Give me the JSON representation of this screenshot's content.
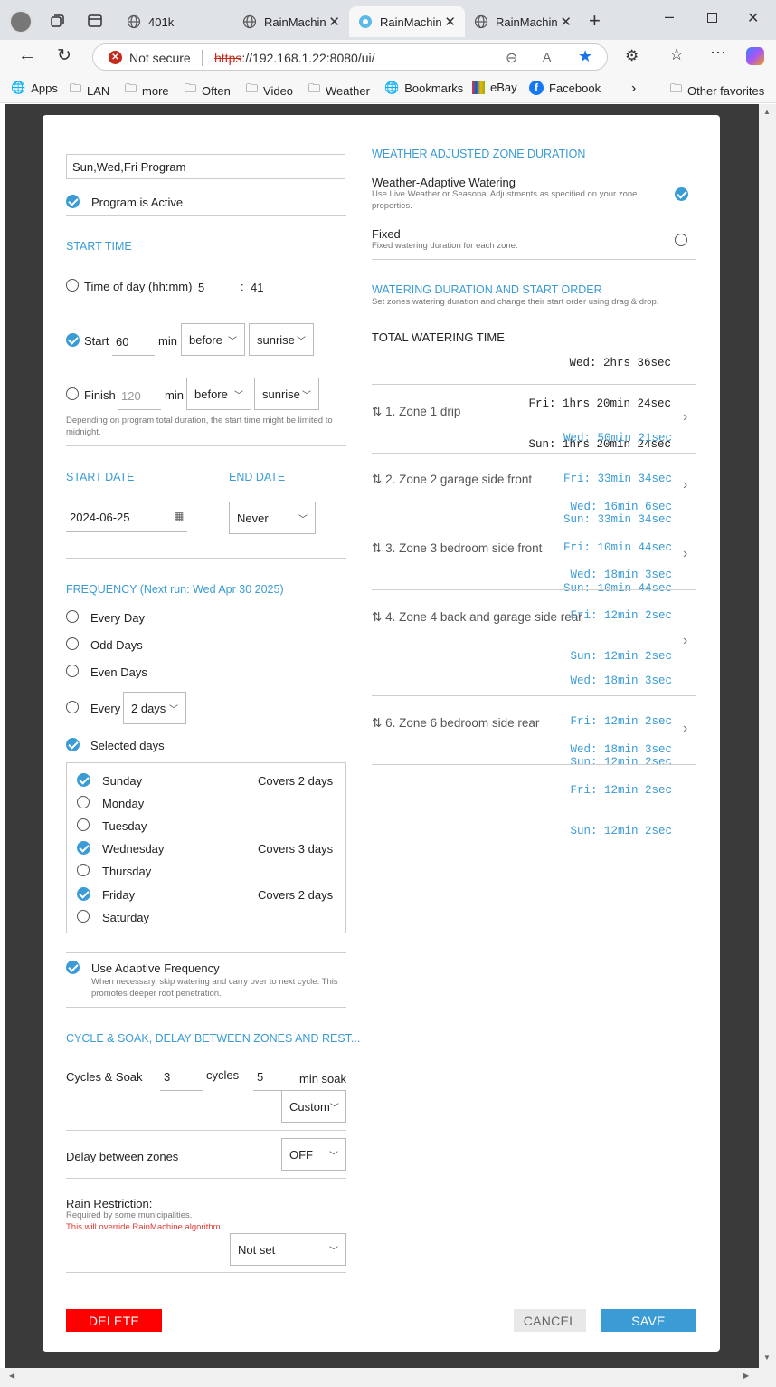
{
  "browser": {
    "tabs": [
      {
        "label": "401k"
      },
      {
        "label": "RainMachine"
      },
      {
        "label": "RainMachine"
      },
      {
        "label": "RainMachine"
      }
    ],
    "security_label": "Not secure",
    "url_scheme": "https",
    "url_rest": "://192.168.1.22:8080/ui/",
    "bookmarks": [
      "Apps",
      "LAN",
      "more",
      "Often",
      "Video",
      "Weather",
      "Bookmarks",
      "eBay",
      "Facebook"
    ],
    "other_favorites": "Other favorites"
  },
  "program": {
    "name": "Sun,Wed,Fri Program",
    "active_label": "Program is Active"
  },
  "start_time": {
    "heading": "START TIME",
    "time_of_day_label": "Time of day (hh:mm)",
    "hh": "5",
    "mm": "41",
    "colon": ":",
    "start_label": "Start",
    "start_value": "60",
    "finish_label": "Finish",
    "finish_value": "120",
    "min_label": "min",
    "before_label": "before",
    "sunrise_label": "sunrise",
    "note": "Depending on program total duration, the start time might be limited to midnight."
  },
  "dates": {
    "start_heading": "START DATE",
    "end_heading": "END DATE",
    "start_value": "2024-06-25",
    "end_value": "Never"
  },
  "frequency": {
    "heading": "FREQUENCY (Next run: Wed Apr 30 2025)",
    "every_day": "Every Day",
    "odd_days": "Odd Days",
    "even_days": "Even Days",
    "every": "Every",
    "every_value": "2 days",
    "selected_days": "Selected days",
    "days": [
      {
        "name": "Sunday",
        "covers": "Covers 2 days"
      },
      {
        "name": "Monday",
        "covers": ""
      },
      {
        "name": "Tuesday",
        "covers": ""
      },
      {
        "name": "Wednesday",
        "covers": "Covers 3 days"
      },
      {
        "name": "Thursday",
        "covers": ""
      },
      {
        "name": "Friday",
        "covers": "Covers 2 days"
      },
      {
        "name": "Saturday",
        "covers": ""
      }
    ],
    "adaptive_label": "Use Adaptive Frequency",
    "adaptive_note": "When necessary, skip watering and carry over to next cycle. This promotes deeper root penetration."
  },
  "cycle": {
    "heading": "CYCLE & SOAK, DELAY BETWEEN ZONES AND REST...",
    "cycles_soak_label": "Cycles & Soak",
    "cycles_value": "3",
    "cycles_label": "cycles",
    "soak_value": "5",
    "soak_label": "min soak",
    "custom_label": "Custom",
    "delay_label": "Delay between zones",
    "delay_value": "OFF",
    "rain_label": "Rain Restriction:",
    "rain_note": "Required by some municipalities.",
    "rain_warning": "This will override RainMachine algorithm.",
    "rain_value": "Not set"
  },
  "weather": {
    "heading": "WEATHER ADJUSTED ZONE DURATION",
    "adaptive_label": "Weather-Adaptive Watering",
    "adaptive_note": "Use Live Weather or Seasonal Adjustments as specified on your zone properties.",
    "fixed_label": "Fixed",
    "fixed_note": "Fixed watering duration for each zone."
  },
  "watering": {
    "heading": "WATERING DURATION AND START ORDER",
    "note": "Set zones watering duration and change their start order using drag & drop.",
    "total_label": "TOTAL WATERING TIME",
    "total_lines": [
      "Wed: 2hrs 36sec",
      "Fri: 1hrs 20min 24sec",
      "Sun: 1hrs 20min 24sec"
    ],
    "zones": [
      {
        "label": "1. Zone 1 drip",
        "times": [
          "Wed: 50min 21sec",
          "Fri: 33min 34sec",
          "Sun: 33min 34sec"
        ]
      },
      {
        "label": "2. Zone 2 garage side front",
        "times": [
          "Wed: 16min 6sec",
          "Fri: 10min 44sec",
          "Sun: 10min 44sec"
        ]
      },
      {
        "label": "3. Zone 3 bedroom side front",
        "times": [
          "Wed: 18min 3sec",
          "Fri: 12min 2sec",
          "Sun: 12min 2sec"
        ]
      },
      {
        "label": "4. Zone 4 back and garage side rear",
        "times": [
          "Wed: 18min 3sec",
          "Fri: 12min 2sec",
          "Sun: 12min 2sec"
        ]
      },
      {
        "label": "6. Zone 6 bedroom side rear",
        "times": [
          "Wed: 18min 3sec",
          "Fri: 12min 2sec",
          "Sun: 12min 2sec"
        ]
      }
    ]
  },
  "actions": {
    "delete": "DELETE",
    "cancel": "CANCEL",
    "save": "SAVE"
  },
  "colors": {
    "accent": "#3a9bd5",
    "delete": "#ff0000",
    "warning": "#e53935"
  }
}
